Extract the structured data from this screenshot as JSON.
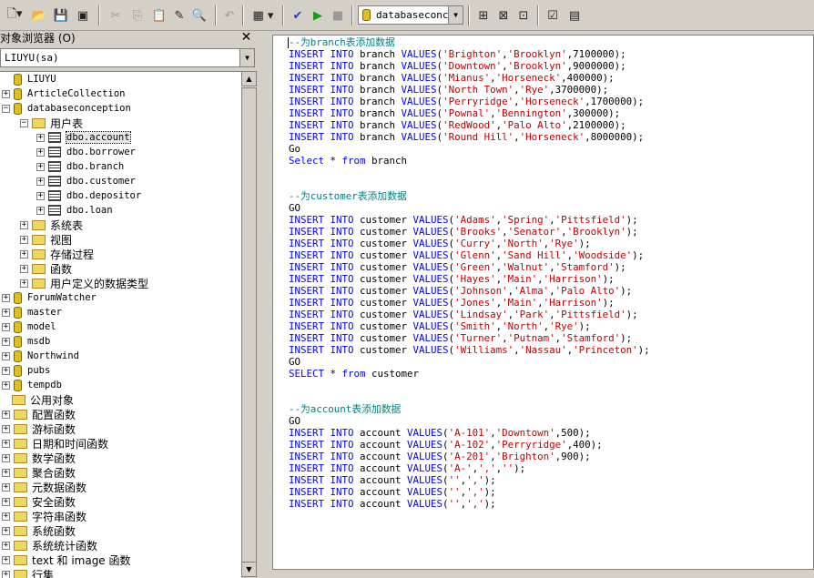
{
  "toolbar": {
    "database": "databaseconce"
  },
  "object_browser": {
    "title": "对象浏览器 (O)",
    "close": "✕",
    "connection": "LIUYU(sa)"
  },
  "tree": {
    "root": "LIUYU",
    "dbs": [
      "ArticleCollection",
      "databaseconception",
      "ForumWatcher",
      "master",
      "model",
      "msdb",
      "Northwind",
      "pubs",
      "tempdb"
    ],
    "user_tables_label": "用户表",
    "tables": [
      "dbo.account",
      "dbo.borrower",
      "dbo.branch",
      "dbo.customer",
      "dbo.depositor",
      "dbo.loan"
    ],
    "db_children": [
      "系统表",
      "视图",
      "存储过程",
      "函数",
      "用户定义的数据类型"
    ],
    "common_objects": "公用对象",
    "common_children": [
      "配置函数",
      "游标函数",
      "日期和时间函数",
      "数学函数",
      "聚合函数",
      "元数据函数",
      "安全函数",
      "字符串函数",
      "系统函数",
      "系统统计函数",
      "text 和 image 函数",
      "行集"
    ]
  },
  "editor": {
    "lines": [
      [
        [
          "cm",
          "--为branch表添加数据"
        ]
      ],
      [
        [
          "kw",
          "INSERT INTO"
        ],
        [
          "",
          "branch "
        ],
        [
          "kw",
          "VALUES"
        ],
        [
          "",
          "("
        ],
        [
          "str",
          "'Brighton'"
        ],
        [
          "",
          ","
        ],
        [
          "str",
          "'Brooklyn'"
        ],
        [
          "",
          ",7100000);"
        ]
      ],
      [
        [
          "kw",
          "INSERT INTO"
        ],
        [
          "",
          "branch "
        ],
        [
          "kw",
          "VALUES"
        ],
        [
          "",
          "("
        ],
        [
          "str",
          "'Downtown'"
        ],
        [
          "",
          ","
        ],
        [
          "str",
          "'Brooklyn'"
        ],
        [
          "",
          ",9000000);"
        ]
      ],
      [
        [
          "kw",
          "INSERT INTO"
        ],
        [
          "",
          "branch "
        ],
        [
          "kw",
          "VALUES"
        ],
        [
          "",
          "("
        ],
        [
          "str",
          "'Mianus'"
        ],
        [
          "",
          ","
        ],
        [
          "str",
          "'Horseneck'"
        ],
        [
          "",
          ",400000);"
        ]
      ],
      [
        [
          "kw",
          "INSERT INTO"
        ],
        [
          "",
          "branch "
        ],
        [
          "kw",
          "VALUES"
        ],
        [
          "",
          "("
        ],
        [
          "str",
          "'North Town'"
        ],
        [
          "",
          ","
        ],
        [
          "str",
          "'Rye'"
        ],
        [
          "",
          ",3700000);"
        ]
      ],
      [
        [
          "kw",
          "INSERT INTO"
        ],
        [
          "",
          "branch "
        ],
        [
          "kw",
          "VALUES"
        ],
        [
          "",
          "("
        ],
        [
          "str",
          "'Perryridge'"
        ],
        [
          "",
          ","
        ],
        [
          "str",
          "'Horseneck'"
        ],
        [
          "",
          ",1700000);"
        ]
      ],
      [
        [
          "kw",
          "INSERT INTO"
        ],
        [
          "",
          "branch "
        ],
        [
          "kw",
          "VALUES"
        ],
        [
          "",
          "("
        ],
        [
          "str",
          "'Pownal'"
        ],
        [
          "",
          ","
        ],
        [
          "str",
          "'Bennington'"
        ],
        [
          "",
          ",300000);"
        ]
      ],
      [
        [
          "kw",
          "INSERT INTO"
        ],
        [
          "",
          "branch "
        ],
        [
          "kw",
          "VALUES"
        ],
        [
          "",
          "("
        ],
        [
          "str",
          "'RedWood'"
        ],
        [
          "",
          ","
        ],
        [
          "str",
          "'Palo Alto'"
        ],
        [
          "",
          ",2100000);"
        ]
      ],
      [
        [
          "kw",
          "INSERT INTO"
        ],
        [
          "",
          "branch "
        ],
        [
          "kw",
          "VALUES"
        ],
        [
          "",
          "("
        ],
        [
          "str",
          "'Round Hill'"
        ],
        [
          "",
          ","
        ],
        [
          "str",
          "'Horseneck'"
        ],
        [
          "",
          ",8000000);"
        ]
      ],
      [
        [
          "",
          "Go"
        ]
      ],
      [
        [
          "kw",
          "Select"
        ],
        [
          "",
          " * "
        ],
        [
          "kw",
          "from"
        ],
        [
          "",
          " branch"
        ]
      ],
      [],
      [],
      [
        [
          "cm",
          "--为customer表添加数据"
        ]
      ],
      [
        [
          "",
          "GO"
        ]
      ],
      [
        [
          "kw",
          "INSERT INTO"
        ],
        [
          "",
          "customer "
        ],
        [
          "kw",
          "VALUES"
        ],
        [
          "",
          "("
        ],
        [
          "str",
          "'Adams'"
        ],
        [
          "",
          ","
        ],
        [
          "str",
          "'Spring'"
        ],
        [
          "",
          ","
        ],
        [
          "str",
          "'Pittsfield'"
        ],
        [
          "",
          ");"
        ]
      ],
      [
        [
          "kw",
          "INSERT INTO"
        ],
        [
          "",
          "customer "
        ],
        [
          "kw",
          "VALUES"
        ],
        [
          "",
          "("
        ],
        [
          "str",
          "'Brooks'"
        ],
        [
          "",
          ","
        ],
        [
          "str",
          "'Senator'"
        ],
        [
          "",
          ","
        ],
        [
          "str",
          "'Brooklyn'"
        ],
        [
          "",
          ");"
        ]
      ],
      [
        [
          "kw",
          "INSERT INTO"
        ],
        [
          "",
          "customer "
        ],
        [
          "kw",
          "VALUES"
        ],
        [
          "",
          "("
        ],
        [
          "str",
          "'Curry'"
        ],
        [
          "",
          ","
        ],
        [
          "str",
          "'North'"
        ],
        [
          "",
          ","
        ],
        [
          "str",
          "'Rye'"
        ],
        [
          "",
          ");"
        ]
      ],
      [
        [
          "kw",
          "INSERT INTO"
        ],
        [
          "",
          "customer "
        ],
        [
          "kw",
          "VALUES"
        ],
        [
          "",
          "("
        ],
        [
          "str",
          "'Glenn'"
        ],
        [
          "",
          ","
        ],
        [
          "str",
          "'Sand Hill'"
        ],
        [
          "",
          ","
        ],
        [
          "str",
          "'Woodside'"
        ],
        [
          "",
          ");"
        ]
      ],
      [
        [
          "kw",
          "INSERT INTO"
        ],
        [
          "",
          "customer "
        ],
        [
          "kw",
          "VALUES"
        ],
        [
          "",
          "("
        ],
        [
          "str",
          "'Green'"
        ],
        [
          "",
          ","
        ],
        [
          "str",
          "'Walnut'"
        ],
        [
          "",
          ","
        ],
        [
          "str",
          "'Stamford'"
        ],
        [
          "",
          ");"
        ]
      ],
      [
        [
          "kw",
          "INSERT INTO"
        ],
        [
          "",
          "customer "
        ],
        [
          "kw",
          "VALUES"
        ],
        [
          "",
          "("
        ],
        [
          "str",
          "'Hayes'"
        ],
        [
          "",
          ","
        ],
        [
          "str",
          "'Main'"
        ],
        [
          "",
          ","
        ],
        [
          "str",
          "'Harrison'"
        ],
        [
          "",
          ");"
        ]
      ],
      [
        [
          "kw",
          "INSERT INTO"
        ],
        [
          "",
          "customer "
        ],
        [
          "kw",
          "VALUES"
        ],
        [
          "",
          "("
        ],
        [
          "str",
          "'Johnson'"
        ],
        [
          "",
          ","
        ],
        [
          "str",
          "'Alma'"
        ],
        [
          "",
          ","
        ],
        [
          "str",
          "'Palo Alto'"
        ],
        [
          "",
          ");"
        ]
      ],
      [
        [
          "kw",
          "INSERT INTO"
        ],
        [
          "",
          "customer "
        ],
        [
          "kw",
          "VALUES"
        ],
        [
          "",
          "("
        ],
        [
          "str",
          "'Jones'"
        ],
        [
          "",
          ","
        ],
        [
          "str",
          "'Main'"
        ],
        [
          "",
          ","
        ],
        [
          "str",
          "'Harrison'"
        ],
        [
          "",
          ");"
        ]
      ],
      [
        [
          "kw",
          "INSERT INTO"
        ],
        [
          "",
          "customer "
        ],
        [
          "kw",
          "VALUES"
        ],
        [
          "",
          "("
        ],
        [
          "str",
          "'Lindsay'"
        ],
        [
          "",
          ","
        ],
        [
          "str",
          "'Park'"
        ],
        [
          "",
          ","
        ],
        [
          "str",
          "'Pittsfield'"
        ],
        [
          "",
          ");"
        ]
      ],
      [
        [
          "kw",
          "INSERT INTO"
        ],
        [
          "",
          "customer "
        ],
        [
          "kw",
          "VALUES"
        ],
        [
          "",
          "("
        ],
        [
          "str",
          "'Smith'"
        ],
        [
          "",
          ","
        ],
        [
          "str",
          "'North'"
        ],
        [
          "",
          ","
        ],
        [
          "str",
          "'Rye'"
        ],
        [
          "",
          ");"
        ]
      ],
      [
        [
          "kw",
          "INSERT INTO"
        ],
        [
          "",
          "customer "
        ],
        [
          "kw",
          "VALUES"
        ],
        [
          "",
          "("
        ],
        [
          "str",
          "'Turner'"
        ],
        [
          "",
          ","
        ],
        [
          "str",
          "'Putnam'"
        ],
        [
          "",
          ","
        ],
        [
          "str",
          "'Stamford'"
        ],
        [
          "",
          ");"
        ]
      ],
      [
        [
          "kw",
          "INSERT INTO"
        ],
        [
          "",
          "customer "
        ],
        [
          "kw",
          "VALUES"
        ],
        [
          "",
          "("
        ],
        [
          "str",
          "'Williams'"
        ],
        [
          "",
          ","
        ],
        [
          "str",
          "'Nassau'"
        ],
        [
          "",
          ","
        ],
        [
          "str",
          "'Princeton'"
        ],
        [
          "",
          ");"
        ]
      ],
      [
        [
          "",
          "GO"
        ]
      ],
      [
        [
          "kw",
          "SELECT"
        ],
        [
          "",
          " * "
        ],
        [
          "kw",
          "from"
        ],
        [
          "",
          " customer"
        ]
      ],
      [],
      [],
      [
        [
          "cm",
          "--为account表添加数据"
        ]
      ],
      [
        [
          "",
          "GO"
        ]
      ],
      [
        [
          "kw",
          "INSERT INTO"
        ],
        [
          "",
          "account "
        ],
        [
          "kw",
          "VALUES"
        ],
        [
          "",
          "("
        ],
        [
          "str",
          "'A-101'"
        ],
        [
          "",
          ","
        ],
        [
          "str",
          "'Downtown'"
        ],
        [
          "",
          ",500);"
        ]
      ],
      [
        [
          "kw",
          "INSERT INTO"
        ],
        [
          "",
          "account "
        ],
        [
          "kw",
          "VALUES"
        ],
        [
          "",
          "("
        ],
        [
          "str",
          "'A-102'"
        ],
        [
          "",
          ","
        ],
        [
          "str",
          "'Perryridge'"
        ],
        [
          "",
          ",400);"
        ]
      ],
      [
        [
          "kw",
          "INSERT INTO"
        ],
        [
          "",
          "account "
        ],
        [
          "kw",
          "VALUES"
        ],
        [
          "",
          "("
        ],
        [
          "str",
          "'A-201'"
        ],
        [
          "",
          ","
        ],
        [
          "str",
          "'Brighton'"
        ],
        [
          "",
          ",900);"
        ]
      ],
      [
        [
          "kw",
          "INSERT INTO"
        ],
        [
          "",
          "account "
        ],
        [
          "kw",
          "VALUES"
        ],
        [
          "",
          "("
        ],
        [
          "str",
          "'A-'"
        ],
        [
          "",
          ","
        ],
        [
          "str",
          "','"
        ],
        [
          "",
          ","
        ],
        [
          "str",
          "''"
        ],
        [
          "",
          ");"
        ]
      ],
      [
        [
          "kw",
          "INSERT INTO"
        ],
        [
          "",
          "account "
        ],
        [
          "kw",
          "VALUES"
        ],
        [
          "",
          "("
        ],
        [
          "str",
          "''"
        ],
        [
          "",
          ","
        ],
        [
          "str",
          "','"
        ],
        [
          "",
          ");"
        ]
      ],
      [
        [
          "kw",
          "INSERT INTO"
        ],
        [
          "",
          "account "
        ],
        [
          "kw",
          "VALUES"
        ],
        [
          "",
          "("
        ],
        [
          "str",
          "''"
        ],
        [
          "",
          ","
        ],
        [
          "str",
          "','"
        ],
        [
          "",
          ");"
        ]
      ],
      [
        [
          "kw",
          "INSERT INTO"
        ],
        [
          "",
          "account "
        ],
        [
          "kw",
          "VALUES"
        ],
        [
          "",
          "("
        ],
        [
          "str",
          "''"
        ],
        [
          "",
          ","
        ],
        [
          "str",
          "','"
        ],
        [
          "",
          ");"
        ]
      ]
    ]
  }
}
